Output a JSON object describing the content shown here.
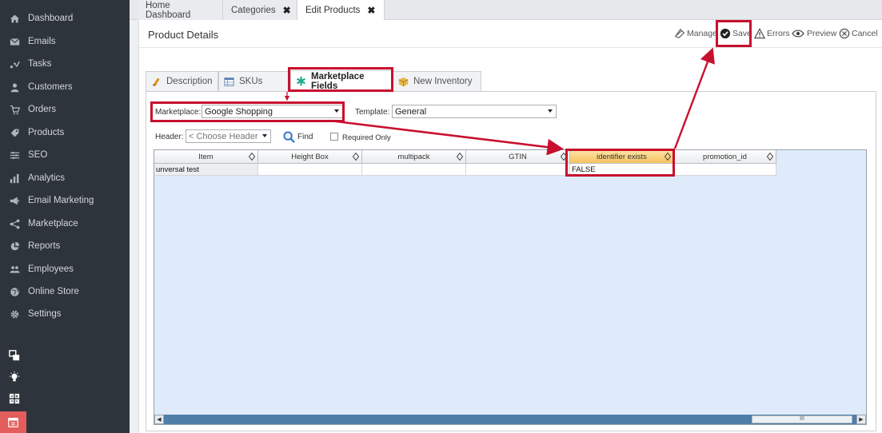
{
  "sidebar": {
    "items": [
      {
        "label": "Dashboard",
        "icon": "home-icon"
      },
      {
        "label": "Emails",
        "icon": "envelope-icon"
      },
      {
        "label": "Tasks",
        "icon": "tasks-icon"
      },
      {
        "label": "Customers",
        "icon": "user-icon"
      },
      {
        "label": "Orders",
        "icon": "cart-icon"
      },
      {
        "label": "Products",
        "icon": "tag-icon"
      },
      {
        "label": "SEO",
        "icon": "sliders-icon"
      },
      {
        "label": "Analytics",
        "icon": "bar-chart-icon"
      },
      {
        "label": "Email Marketing",
        "icon": "megaphone-icon"
      },
      {
        "label": "Marketplace",
        "icon": "share-icon"
      },
      {
        "label": "Reports",
        "icon": "pie-chart-icon"
      },
      {
        "label": "Employees",
        "icon": "group-icon"
      },
      {
        "label": "Online Store",
        "icon": "globe-icon"
      },
      {
        "label": "Settings",
        "icon": "gear-icon"
      }
    ],
    "bottom_icons": [
      "windows-icon",
      "lightbulb-icon",
      "calculator-icon",
      "calendar-icon"
    ]
  },
  "tabs": [
    {
      "label": "Home Dashboard",
      "closable": false
    },
    {
      "label": "Categories",
      "closable": true,
      "close": "✖"
    },
    {
      "label": "Edit Products",
      "closable": true,
      "close": "✖",
      "active": true
    }
  ],
  "page": {
    "title": "Product Details",
    "actions": [
      {
        "label": "Manage",
        "icon": "manage-icon"
      },
      {
        "label": "Save",
        "icon": "check-circle-icon"
      },
      {
        "label": "Errors",
        "icon": "warning-icon"
      },
      {
        "label": "Preview",
        "icon": "eye-icon"
      },
      {
        "label": "Cancel",
        "icon": "cancel-icon"
      }
    ]
  },
  "inner_tabs": [
    {
      "label": "Description",
      "icon": "description-icon"
    },
    {
      "label": "SKUs",
      "icon": "table-icon"
    },
    {
      "label": "Marketplace Fields",
      "icon": "asterisk-icon",
      "active": true
    },
    {
      "label": "New Inventory",
      "icon": "box-icon"
    }
  ],
  "form": {
    "marketplace_label": "Marketplace:",
    "marketplace_value": "Google Shopping",
    "template_label": "Template:",
    "template_value": "General",
    "header_label": "Header:",
    "header_placeholder": "< Choose Header",
    "find_label": "Find",
    "required_only_label": "Required Only"
  },
  "grid": {
    "columns": [
      "Item",
      "Height Box",
      "multipack",
      "GTIN",
      "identifier exists",
      "promotion_id"
    ],
    "rows": [
      [
        "unversal test",
        "",
        "",
        "",
        "FALSE",
        ""
      ]
    ],
    "selected_column": "identifier exists",
    "scroll_left": "◀",
    "scroll_right": "▶",
    "thumb_grip": "III"
  },
  "colors": {
    "sidebar_bg": "#2e343b",
    "annotation_red": "#c8102e",
    "grid_bg": "#dfeafb",
    "selected_header": "#f6c460"
  }
}
